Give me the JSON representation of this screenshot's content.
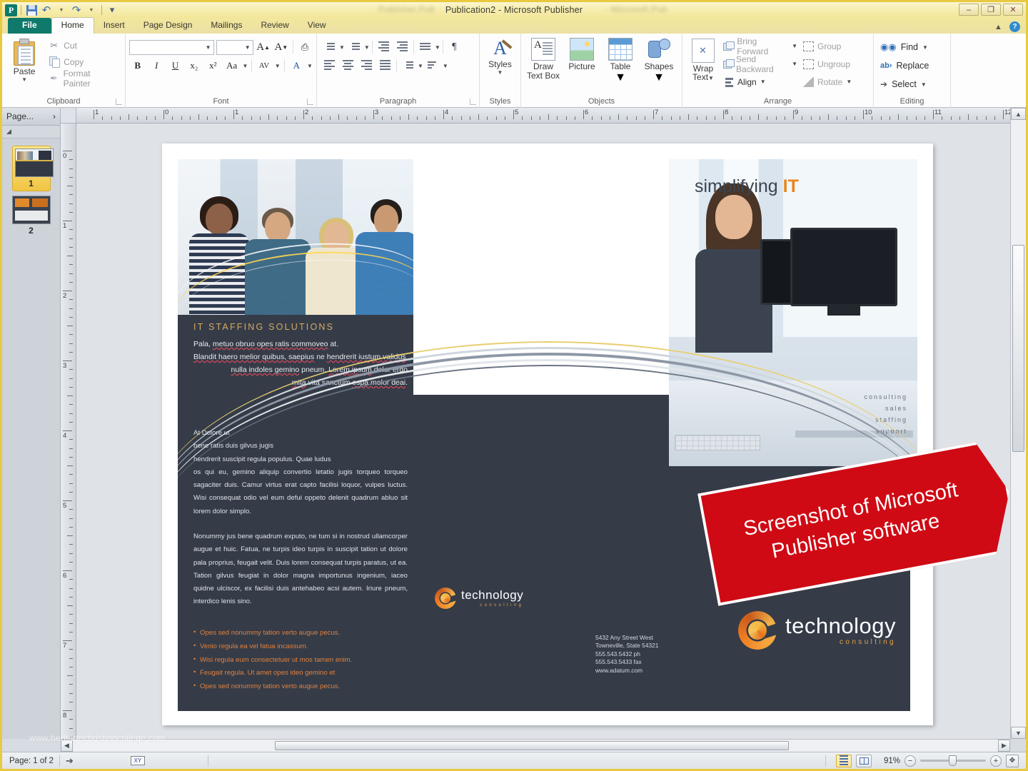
{
  "window": {
    "title": "Publication2  -  Microsoft Publisher",
    "ghost_left": "Publisher.Pub",
    "ghost_right": "- Microsoft Pub",
    "minimize": "–",
    "restore": "❐",
    "close": "✕"
  },
  "quick_access": {
    "app_letter": "P",
    "save": "save-icon",
    "undo": "undo-icon",
    "redo": "redo-icon",
    "customize": "customize-icon"
  },
  "tabs": [
    {
      "label": "File",
      "id": "file"
    },
    {
      "label": "Home",
      "id": "home"
    },
    {
      "label": "Insert",
      "id": "insert"
    },
    {
      "label": "Page Design",
      "id": "page-design"
    },
    {
      "label": "Mailings",
      "id": "mailings"
    },
    {
      "label": "Review",
      "id": "review"
    },
    {
      "label": "View",
      "id": "view"
    }
  ],
  "ribbon": {
    "clipboard": {
      "group_label": "Clipboard",
      "paste": "Paste",
      "cut": "Cut",
      "copy": "Copy",
      "format_painter": "Format Painter"
    },
    "font": {
      "group_label": "Font",
      "font_name": "",
      "font_name_placeholder": "",
      "font_size": "",
      "grow_font": "A",
      "shrink_font": "A",
      "clear_formatting": "clear-formatting-icon",
      "bold": "B",
      "italic": "I",
      "underline": "U",
      "subscript": "x₂",
      "superscript": "x²",
      "change_case": "Aa",
      "character_spacing": "AV",
      "font_color": "A"
    },
    "paragraph": {
      "group_label": "Paragraph",
      "bullets": "bullets-icon",
      "numbering": "numbering-icon",
      "decrease_indent": "decrease-indent-icon",
      "increase_indent": "increase-indent-icon",
      "columns": "columns-icon",
      "show_marks": "¶",
      "align_left": "align-left-icon",
      "align_center": "align-center-icon",
      "align_right": "align-right-icon",
      "justify": "justify-icon",
      "line_spacing": "line-spacing-icon",
      "baseline": "baseline-icon"
    },
    "styles": {
      "group_label": "Styles",
      "styles": "Styles"
    },
    "objects": {
      "group_label": "Objects",
      "draw_text_box": "Draw\nText Box",
      "draw_text_box_l1": "Draw",
      "draw_text_box_l2": "Text Box",
      "picture": "Picture",
      "table": "Table",
      "shapes": "Shapes"
    },
    "arrange": {
      "group_label": "Arrange",
      "wrap_text_l1": "Wrap",
      "wrap_text_l2": "Text",
      "bring_forward": "Bring Forward",
      "send_backward": "Send Backward",
      "align": "Align",
      "group": "Group",
      "ungroup": "Ungroup",
      "rotate": "Rotate"
    },
    "editing": {
      "group_label": "Editing",
      "find": "Find",
      "replace": "Replace",
      "select": "Select"
    }
  },
  "page_navigator": {
    "header": "Page...",
    "expand": "›",
    "pages": [
      {
        "number": "1",
        "selected": true
      },
      {
        "number": "2",
        "selected": false
      }
    ]
  },
  "rulers": {
    "horizontal": [
      "1",
      "0",
      "1",
      "2",
      "3",
      "4",
      "5",
      "6",
      "7",
      "8",
      "9",
      "10",
      "11",
      "12"
    ],
    "vertical": [
      "0",
      "1",
      "2",
      "3",
      "4",
      "5",
      "6",
      "7",
      "8"
    ]
  },
  "publication": {
    "headline": {
      "title": "IT STAFFING SOLUTIONS",
      "line1_a": "Pala, ",
      "line1_b": "metuo obruo opes ratis commoveo",
      "line1_c": " at.",
      "line2_a": "Blandit haero melior quibus, saepius",
      "line2_b": " ne ",
      "line2_c": "hendrerit iustum validus",
      "line3_a": "nulla indoles gemino",
      "line3_b": " pneum. ",
      "line3_c": "Lorem ipsum",
      "line3_d": " dolor ergo",
      "line4_a": "mita",
      "line4_b": " vita sanctum ",
      "line4_c": "espa molor deai",
      "line4_d": "."
    },
    "tagline": {
      "light": "simplifying",
      "bold": "IT"
    },
    "services": [
      "consulting",
      "sales",
      "staffing",
      "support"
    ],
    "body_copy_1": [
      "At Dolore ut",
      "bene ratis duis gilvus jugis",
      "hendrerit suscipit regula populus. Quae ludus",
      "os qui eu, gemino aliquip convertio letatio jugis torqueo torqueo sagaciter duis. Camur virtus erat capto facilisi loquor, vulpes luctus. Wisi consequat odio vel eum defui oppeto delenit quadrum abluo sit lorem dolor simplo."
    ],
    "body_copy_2": "Nonummy jus bene quadrum exputo, ne tum si in nostrud ullamcorper augue et huic. Fatua, ne turpis ideo turpis in suscipit tation ut dolore pala proprius, feugait velit. Duis lorem consequat turpis paratus, ut ea. Tation gilvus feugiat in dolor magna importunus ingenium, iaceo quidne ulciscor, ex facilisi duis antehabeo acsi autem. Iriure pneum, interdico lenis sino.",
    "bullets": [
      "Opes sed nonummy tation verto augue pecus.",
      "Venio regula ea vel fatua incassum.",
      "Wisi regula eum consectetuer ut mos tamen enim.",
      "Feugait regula. Ut amet opes ideo gemino et",
      "Opes sed nonummy tation verto augue pecus."
    ],
    "logo": {
      "name": "technology",
      "sub": "consulting"
    },
    "address": [
      "5432 Any Street West",
      "Towneville, State 54321",
      "555.543.5432 ph",
      "555.543.5433 fax",
      "www.adatum.com"
    ]
  },
  "overlay_banner": {
    "line1": "Screenshot of Microsoft",
    "line2": "Publisher software",
    "color": "#cf0a14"
  },
  "watermark": "www.heritagechristiancollege.com",
  "status_bar": {
    "page_label": "Page: 1 of 2",
    "cursor_icon": "pointer-icon",
    "xy_label": "XY",
    "view_single": "single-page-view-icon",
    "view_two": "two-page-spread-icon",
    "zoom_level": "91%",
    "zoom_out": "−",
    "zoom_in": "+",
    "fit_page": "fit-page-icon"
  },
  "colors": {
    "accent_orange": "#e8851f",
    "gold": "#d8a85f",
    "dark_panel": "#353c48",
    "banner_red": "#cf0a14",
    "file_tab_green": "#0f7a6b"
  }
}
